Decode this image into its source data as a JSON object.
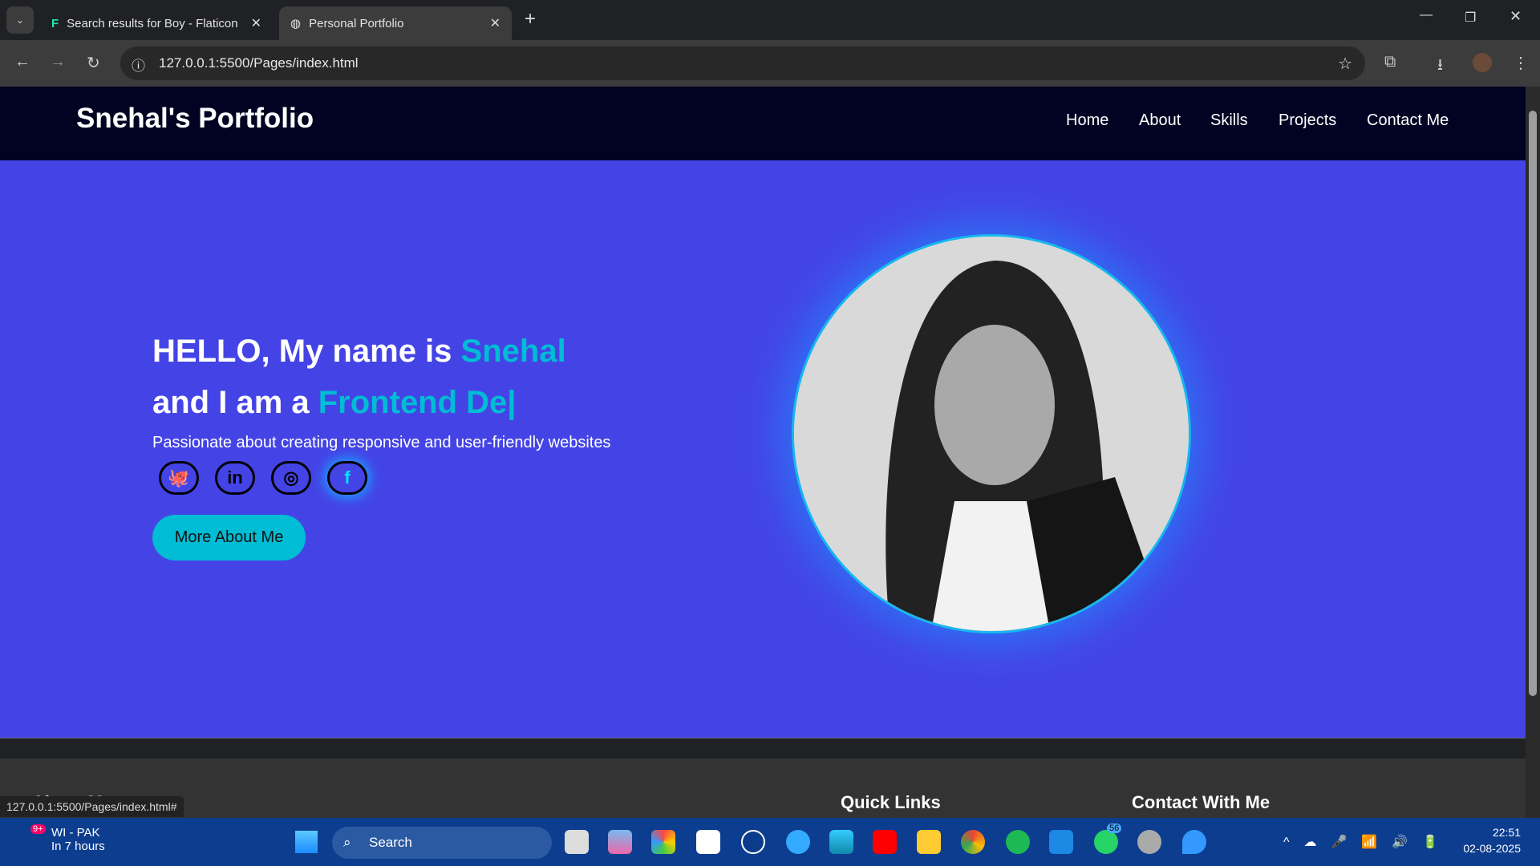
{
  "browser": {
    "tabs": [
      {
        "title": "Search results for Boy - Flaticon"
      },
      {
        "title": "Personal Portfolio"
      }
    ],
    "url": "127.0.0.1:5500/Pages/index.html",
    "status_url": "127.0.0.1:5500/Pages/index.html#"
  },
  "site": {
    "brand": "Snehal's Portfolio",
    "nav": [
      "Home",
      "About",
      "Skills",
      "Projects",
      "Contact Me"
    ]
  },
  "hero": {
    "line1": "HELLO, My name is ",
    "name": "Snehal",
    "line2": "and I am a ",
    "role": "Frontend De|",
    "subtitle": "Passionate about creating responsive and user-friendly websites",
    "button": "More About Me",
    "socials": [
      "github",
      "linkedin",
      "instagram",
      "facebook"
    ],
    "accent": "#00bcd4"
  },
  "footer": {
    "about": "About Me",
    "quick_links": "Quick Links",
    "contact": "Contact With Me"
  },
  "taskbar": {
    "weather_title": "WI - PAK",
    "weather_sub": "In 7 hours",
    "weather_badge": "9+",
    "search": "Search",
    "whatsapp_badge": "56",
    "time": "22:51",
    "date": "02-08-2025"
  }
}
